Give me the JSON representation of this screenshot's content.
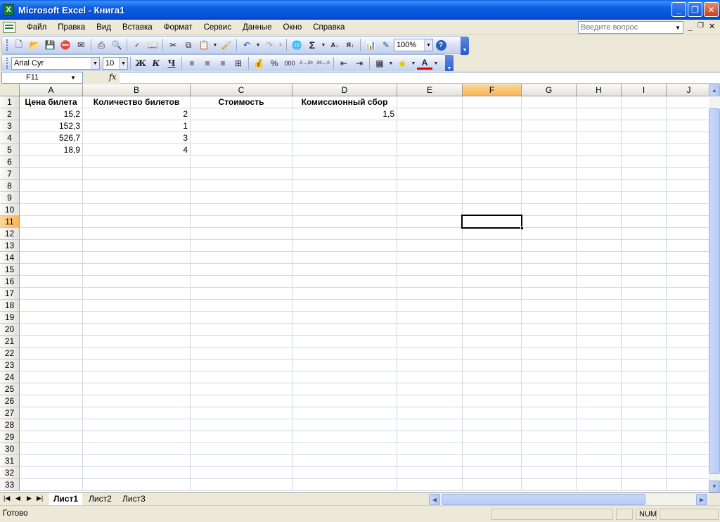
{
  "window": {
    "title": "Microsoft Excel - Книга1",
    "minimize": "_",
    "restore": "❐",
    "close": "✕"
  },
  "menu": {
    "items": [
      "Файл",
      "Правка",
      "Вид",
      "Вставка",
      "Формат",
      "Сервис",
      "Данные",
      "Окно",
      "Справка"
    ],
    "help_placeholder": "Введите вопрос"
  },
  "toolbar_standard": {
    "zoom": "100%",
    "sum_symbol": "Σ"
  },
  "toolbar_format": {
    "font_name": "Arial Cyr",
    "font_size": "10",
    "bold": "Ж",
    "italic": "К",
    "underline": "Ч",
    "percent": "%",
    "thousands": "000",
    "inc_decimal": ",0→,00",
    "dec_decimal": ",00→,0"
  },
  "formula_bar": {
    "name_box": "F11",
    "fx": "fx",
    "content": ""
  },
  "sheet": {
    "columns": [
      "A",
      "B",
      "C",
      "D",
      "E",
      "F",
      "G",
      "H",
      "I",
      "J"
    ],
    "selected_column": "F",
    "selected_row": 11,
    "row_count": 33,
    "cells": {
      "A1": "Цена билета",
      "B1": "Количество билетов",
      "C1": "Стоимость",
      "D1": "Комиссионный сбор",
      "A2": "15,2",
      "B2": "2",
      "D2": "1,5",
      "A3": "152,3",
      "B3": "1",
      "A4": "526,7",
      "B4": "3",
      "A5": "18,9",
      "B5": "4"
    }
  },
  "sheet_tabs": [
    "Лист1",
    "Лист2",
    "Лист3"
  ],
  "active_tab": "Лист1",
  "status": {
    "text": "Готово",
    "num": "NUM"
  }
}
